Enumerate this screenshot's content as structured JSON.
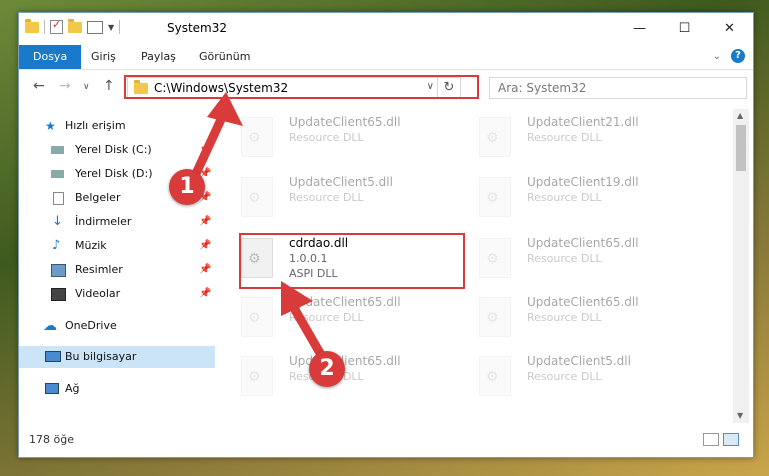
{
  "window": {
    "title": "System32"
  },
  "ribbon": {
    "tabs": [
      "Dosya",
      "Giriş",
      "Paylaş",
      "Görünüm"
    ]
  },
  "nav": {
    "address": "C:\\Windows\\System32",
    "search_placeholder": "Ara: System32"
  },
  "sidebar": {
    "items": [
      {
        "label": "Hızlı erişim",
        "icon": "star-icon"
      },
      {
        "label": "Yerel Disk (C:)",
        "icon": "drive-icon"
      },
      {
        "label": "Yerel Disk (D:)",
        "icon": "drive-icon"
      },
      {
        "label": "Belgeler",
        "icon": "document-icon"
      },
      {
        "label": "İndirmeler",
        "icon": "download-icon"
      },
      {
        "label": "Müzik",
        "icon": "music-icon"
      },
      {
        "label": "Resimler",
        "icon": "pictures-icon"
      },
      {
        "label": "Videolar",
        "icon": "video-icon"
      },
      {
        "label": "OneDrive",
        "icon": "cloud-icon"
      },
      {
        "label": "Bu bilgisayar",
        "icon": "computer-icon"
      },
      {
        "label": "Ağ",
        "icon": "network-icon"
      }
    ]
  },
  "files": [
    {
      "name": "UpdateClient65.dll",
      "type": "Resource DLL"
    },
    {
      "name": "UpdateClient21.dll",
      "type": "Resource DLL"
    },
    {
      "name": "UpdateClient5.dll",
      "type": "Resource DLL"
    },
    {
      "name": "UpdateClient19.dll",
      "type": "Resource DLL"
    },
    {
      "name": "cdrdao.dll",
      "version": "1.0.0.1",
      "type": "ASPI DLL"
    },
    {
      "name": "UpdateClient65.dll",
      "type": "Resource DLL"
    },
    {
      "name": "UpdateClient65.dll",
      "type": "Resource DLL"
    },
    {
      "name": "UpdateClient65.dll",
      "type": "Resource DLL"
    },
    {
      "name": "UpdateClient65.dll",
      "type": "Resource DLL"
    },
    {
      "name": "UpdateClient5.dll",
      "type": "Resource DLL"
    }
  ],
  "status": {
    "count": "178 öğe"
  },
  "badges": {
    "one": "1",
    "two": "2"
  },
  "colors": {
    "accent": "#1979ca",
    "highlight": "#d93b3b"
  }
}
